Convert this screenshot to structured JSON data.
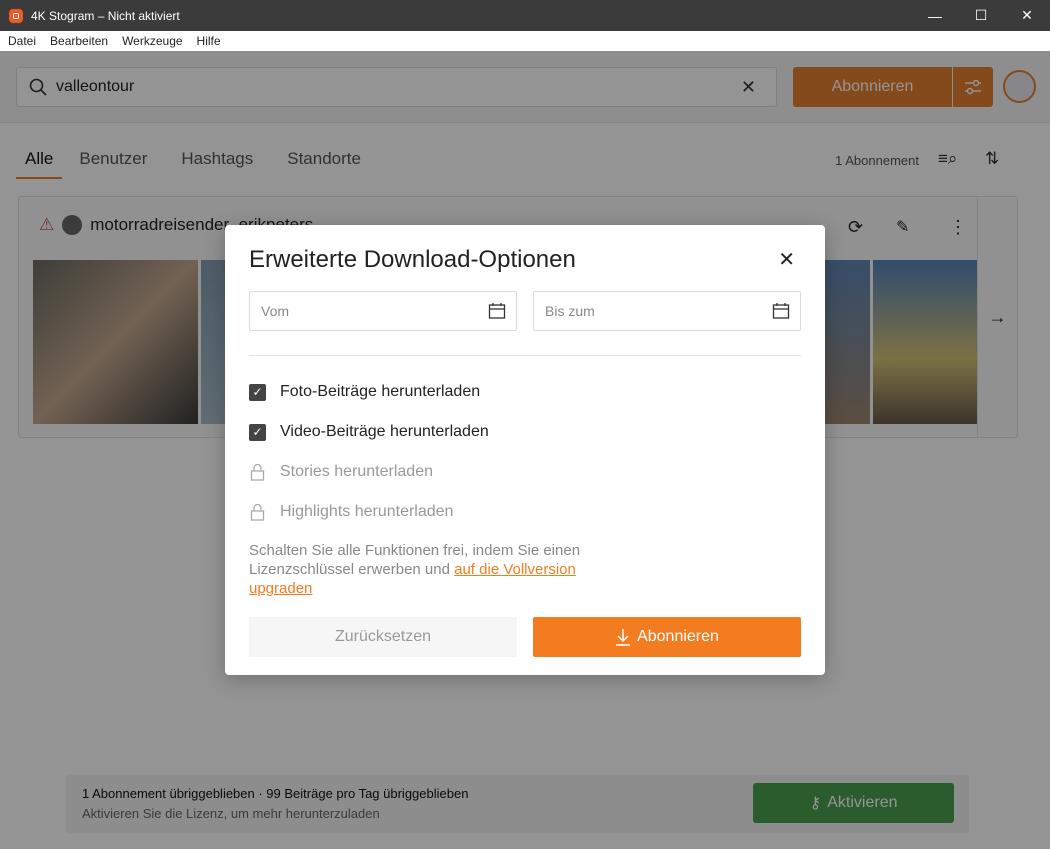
{
  "window": {
    "title": "4K Stogram – Nicht aktiviert",
    "minimize": "—",
    "maximize": "☐",
    "close": "✕"
  },
  "menu": [
    "Datei",
    "Bearbeiten",
    "Werkzeuge",
    "Hilfe"
  ],
  "search": {
    "value": "valleontour",
    "clear": "✕"
  },
  "subscribe_label": "Abonnieren",
  "tabs": [
    "Alle",
    "Benutzer",
    "Hashtags",
    "Standorte"
  ],
  "subscription_count": "1 Abonnement",
  "card": {
    "username": "motorradreisender_erikpeters"
  },
  "footer": {
    "line1": "1 Abonnement übriggeblieben · 99 Beiträge pro Tag übriggeblieben",
    "line2": "Aktivieren Sie die Lizenz, um mehr herunterzuladen",
    "activate": "Aktivieren"
  },
  "dialog": {
    "title": "Erweiterte Download-Optionen",
    "close": "✕",
    "from_placeholder": "Vom",
    "to_placeholder": "Bis zum",
    "options": [
      {
        "label": "Foto-Beiträge herunterladen",
        "checked": true
      },
      {
        "label": "Video-Beiträge herunterladen",
        "checked": true
      },
      {
        "label": "Stories herunterladen",
        "locked": true
      },
      {
        "label": "Highlights herunterladen",
        "locked": true
      }
    ],
    "note_text": "Schalten Sie alle Funktionen frei, indem Sie einen Lizenzschlüssel erwerben und ",
    "note_link": "auf die Vollversion upgraden",
    "reset": "Zurücksetzen",
    "subscribe": "Abonnieren"
  },
  "colors": {
    "accent": "#f47c20",
    "activate": "#3fa244"
  }
}
